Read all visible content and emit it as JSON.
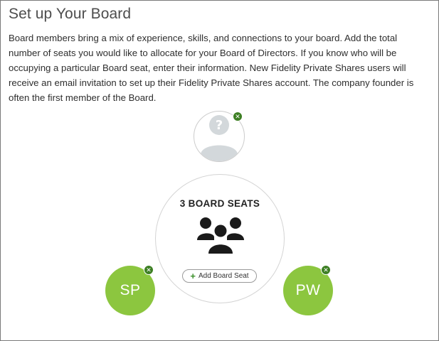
{
  "page": {
    "title": "Set up Your Board",
    "description": "Board members bring a mix of experience, skills, and connections to your board. Add the total number of seats you would like to allocate for your Board of Directors. If you know who will be occupying a particular Board seat, enter their information. New Fidelity Private Shares users will receive an email invitation to set up their Fidelity Private Shares account. The company founder is often the first member of the Board."
  },
  "board": {
    "seat_count_label": "3 BOARD SEATS",
    "add_seat_label": "Add Board Seat",
    "group_icon": "people-group-icon"
  },
  "seats": [
    {
      "initials": "",
      "status": "unassigned",
      "icon": "unknown-person-icon"
    },
    {
      "initials": "SP",
      "status": "assigned"
    },
    {
      "initials": "PW",
      "status": "assigned"
    }
  ],
  "colors": {
    "member_fill": "#8cc63f",
    "remove_badge": "#3d7f23",
    "placeholder_avatar": "#d3d8db"
  }
}
